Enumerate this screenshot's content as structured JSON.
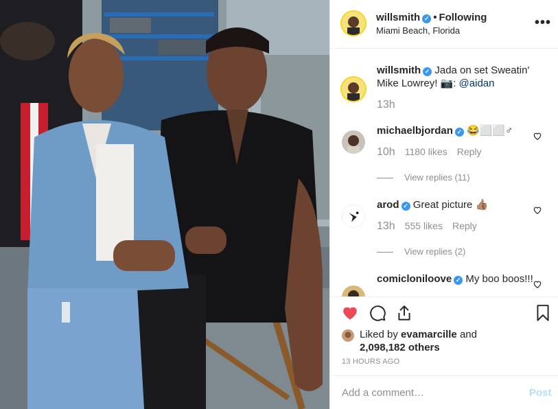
{
  "post": {
    "username": "willsmith",
    "follow_status": "Following",
    "location": "Miami Beach, Florida",
    "more_icon": "more-options-icon",
    "photo_description_icon": "post-photo"
  },
  "comments": [
    {
      "user": "willsmith",
      "verified": true,
      "text": "Jada on set Sweatin' Mike Lowrey! 📷: ",
      "mention": "@aidan",
      "time": "13h"
    },
    {
      "user": "michaelbjordan",
      "verified": true,
      "text": "😂⬜⬜♂",
      "time": "10h",
      "likes": "1180 likes",
      "reply": "Reply",
      "view_replies": "View replies (11)"
    },
    {
      "user": "arod",
      "verified": true,
      "text": "Great picture 👍🏽",
      "time": "13h",
      "likes": "555 likes",
      "reply": "Reply",
      "view_replies": "View replies (2)"
    },
    {
      "user": "comicloniloove",
      "verified": true,
      "text": "My boo boos!!!"
    }
  ],
  "actions": {
    "liked_by_prefix": "Liked by ",
    "liked_by_user": "evamarcille",
    "liked_by_mid": " and",
    "liked_by_count": "2,098,182 others",
    "time_ago": "13 HOURS AGO"
  },
  "add_comment": {
    "placeholder": "Add a comment…",
    "post_label": "Post"
  },
  "colors": {
    "accent": "#3897f0",
    "like_red": "#ed4956",
    "story_ring": "#f5d31b",
    "post_disabled": "#b2dffc"
  }
}
